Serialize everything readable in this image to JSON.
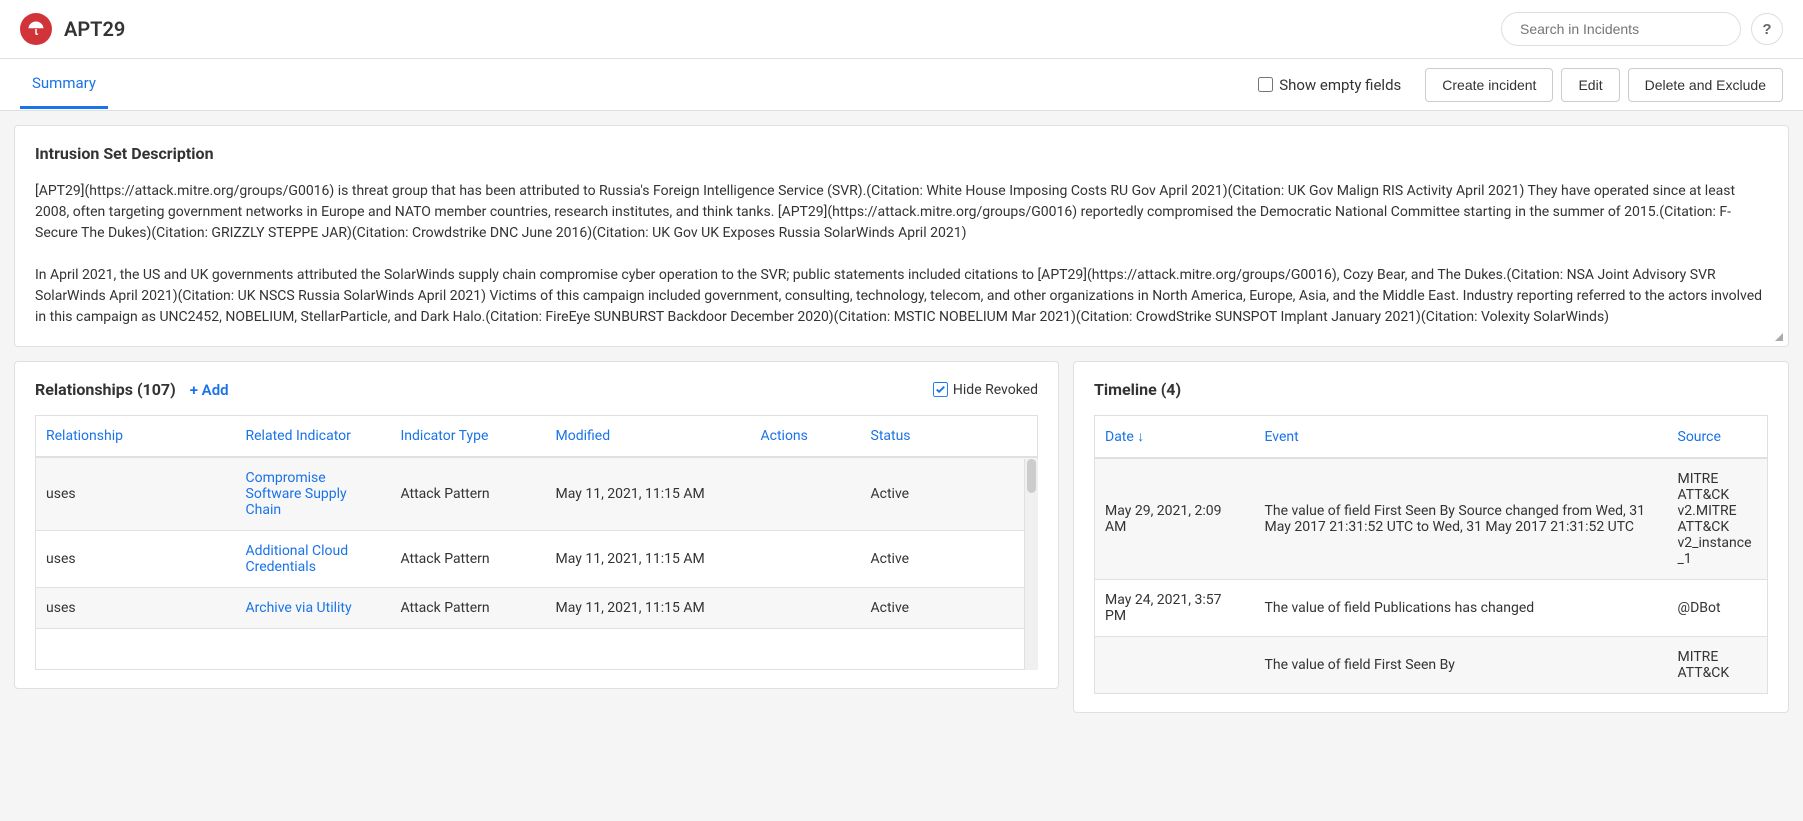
{
  "header": {
    "title": "APT29",
    "search_placeholder": "Search in Incidents",
    "help_label": "?"
  },
  "subheader": {
    "tab_summary": "Summary",
    "show_empty_label": "Show empty fields",
    "create_incident": "Create incident",
    "edit": "Edit",
    "delete_exclude": "Delete and Exclude"
  },
  "description": {
    "title": "Intrusion Set Description",
    "body": "[APT29](https://attack.mitre.org/groups/G0016) is threat group that has been attributed to Russia's Foreign Intelligence Service (SVR).(Citation: White House Imposing Costs RU Gov April 2021)(Citation: UK Gov Malign RIS Activity April 2021) They have operated since at least 2008, often targeting government networks in Europe and NATO member countries, research institutes, and think tanks. [APT29](https://attack.mitre.org/groups/G0016) reportedly compromised the Democratic National Committee starting in the summer of 2015.(Citation: F-Secure The Dukes)(Citation: GRIZZLY STEPPE JAR)(Citation: Crowdstrike DNC June 2016)(Citation: UK Gov UK Exposes Russia SolarWinds April 2021)\n\nIn April 2021, the US and UK governments attributed the SolarWinds supply chain compromise cyber operation to the SVR; public statements included citations to [APT29](https://attack.mitre.org/groups/G0016), Cozy Bear, and The Dukes.(Citation: NSA Joint Advisory SVR SolarWinds April 2021)(Citation: UK NSCS Russia SolarWinds April 2021) Victims of this campaign included government, consulting, technology, telecom, and other organizations in North America, Europe, Asia, and the Middle East. Industry reporting referred to the actors involved in this campaign as UNC2452, NOBELIUM, StellarParticle, and Dark Halo.(Citation: FireEye SUNBURST Backdoor December 2020)(Citation: MSTIC NOBELIUM Mar 2021)(Citation: CrowdStrike SUNSPOT Implant January 2021)(Citation: Volexity SolarWinds)"
  },
  "relationships": {
    "title": "Relationships (107)",
    "add_label": "+ Add",
    "hide_revoked_label": "Hide Revoked",
    "columns": {
      "relationship": "Relationship",
      "related_indicator": "Related Indicator",
      "indicator_type": "Indicator Type",
      "modified": "Modified",
      "actions": "Actions",
      "status": "Status"
    },
    "rows": [
      {
        "rel": "uses",
        "ind": "Compromise Software Supply Chain",
        "type": "Attack Pattern",
        "mod": "May 11, 2021, 11:15 AM",
        "act": "",
        "status": "Active"
      },
      {
        "rel": "uses",
        "ind": "Additional Cloud Credentials",
        "type": "Attack Pattern",
        "mod": "May 11, 2021, 11:15 AM",
        "act": "",
        "status": "Active"
      },
      {
        "rel": "uses",
        "ind": "Archive via Utility",
        "type": "Attack Pattern",
        "mod": "May 11, 2021, 11:15 AM",
        "act": "",
        "status": "Active"
      }
    ]
  },
  "timeline": {
    "title": "Timeline (4)",
    "columns": {
      "date": "Date",
      "event": "Event",
      "source": "Source"
    },
    "rows": [
      {
        "date": "May 29, 2021, 2:09 AM",
        "event": "The value of field First Seen By Source changed from Wed, 31 May 2017 21:31:52 UTC to Wed, 31 May 2017 21:31:52 UTC",
        "source": "MITRE ATT&CK v2.MITRE ATT&CK v2_instance_1"
      },
      {
        "date": "May 24, 2021, 3:57 PM",
        "event": "The value of field Publications has changed",
        "source": "@DBot"
      },
      {
        "date": "",
        "event": "The value of field First Seen By",
        "source": "MITRE ATT&CK"
      }
    ]
  }
}
